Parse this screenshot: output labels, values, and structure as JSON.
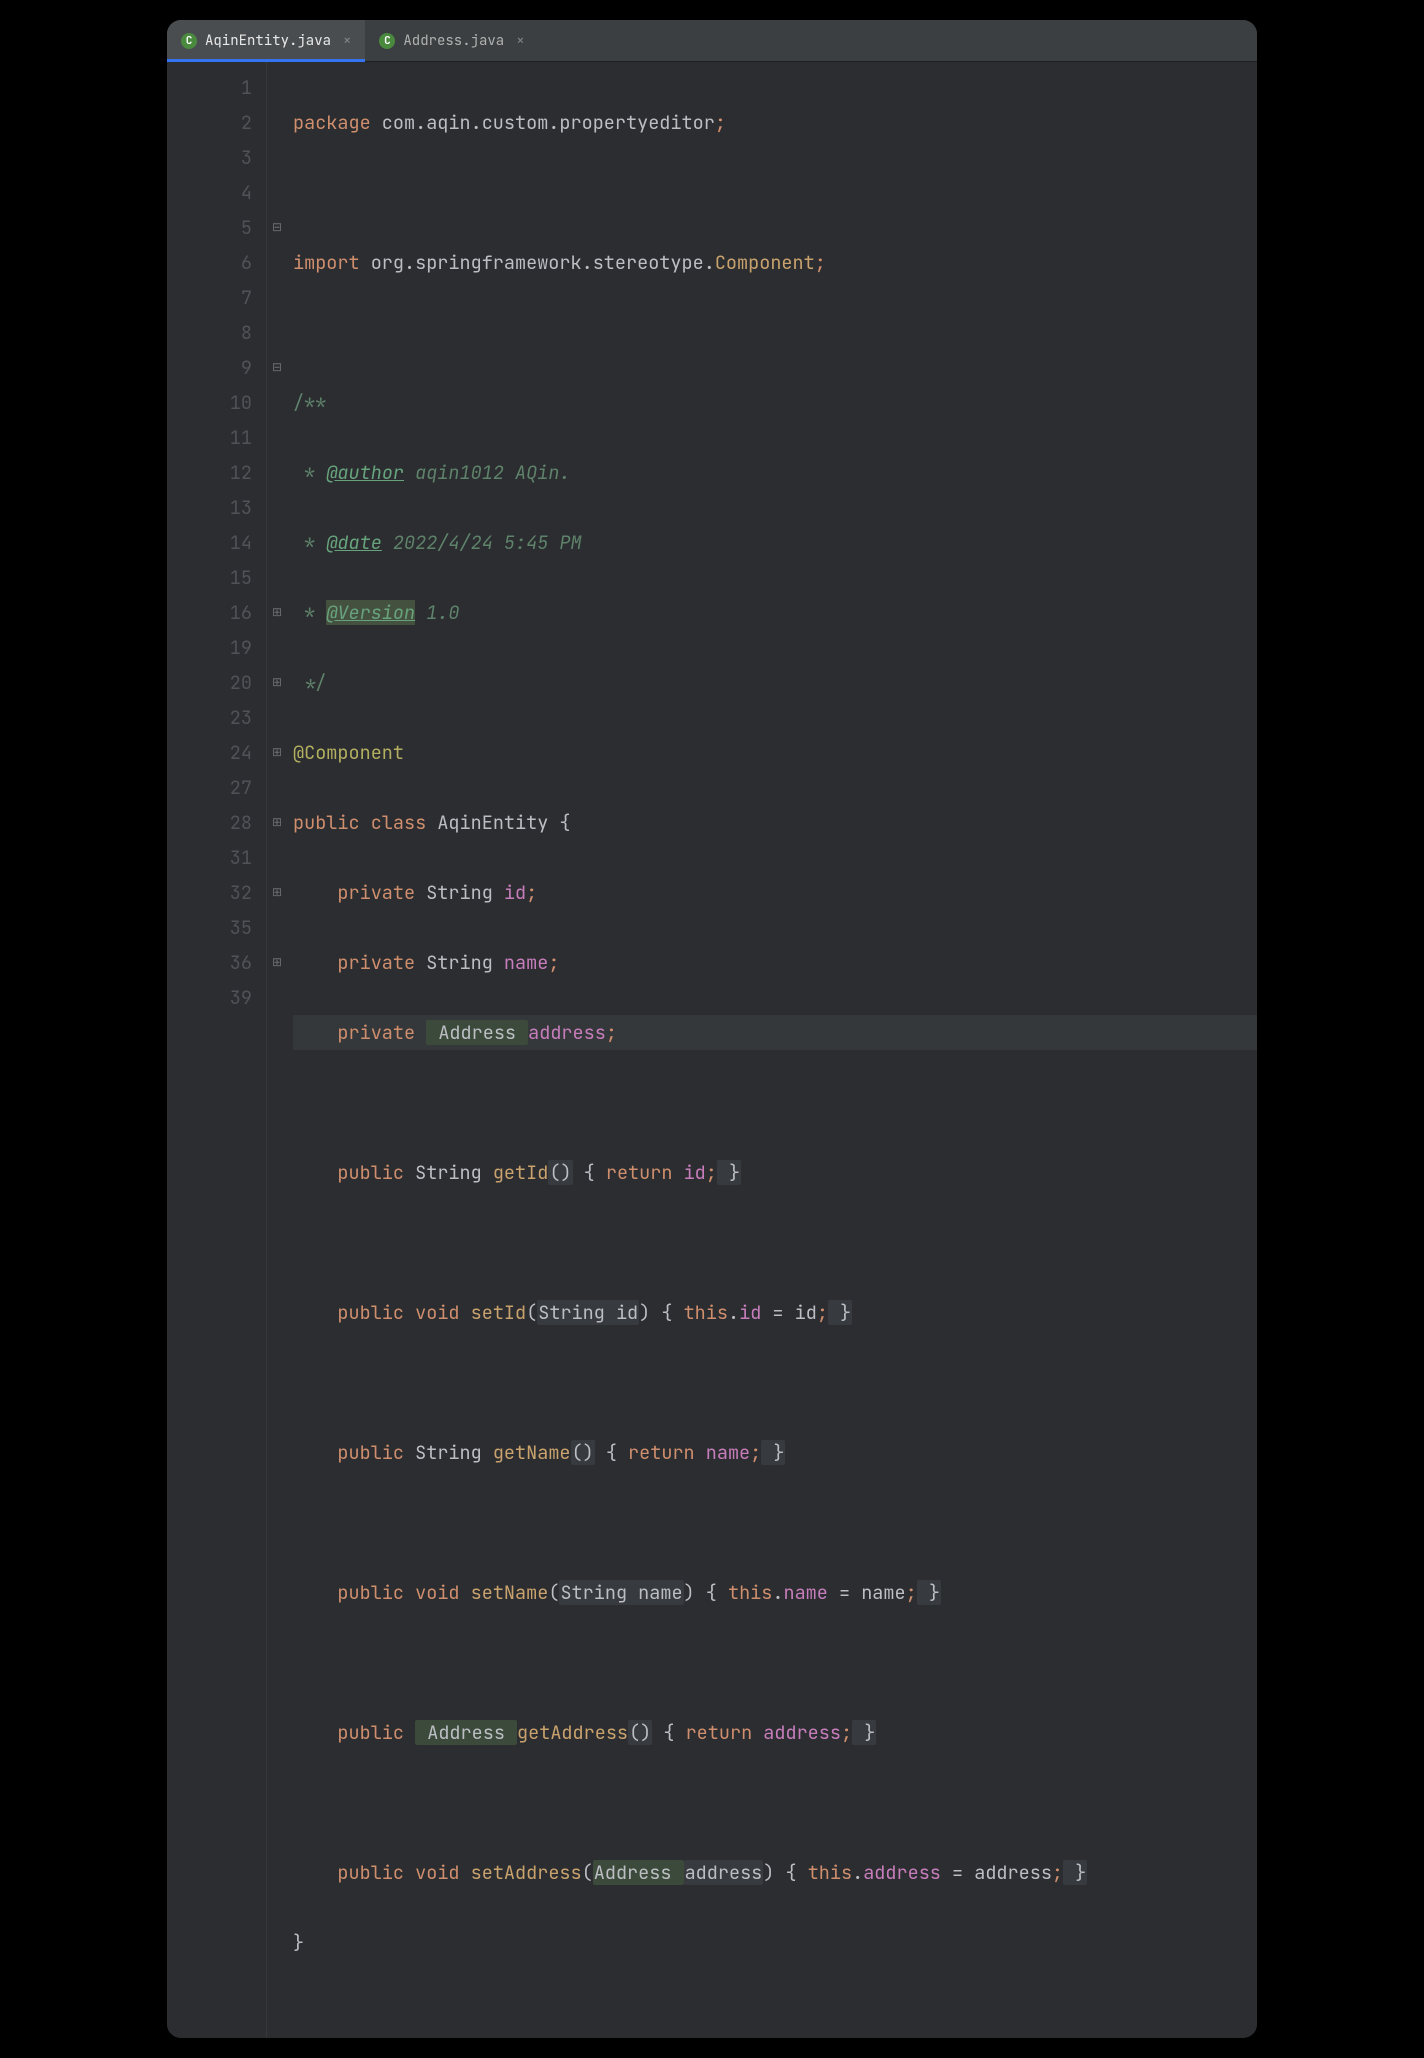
{
  "tabs": [
    {
      "label": "AqinEntity.java",
      "active": true
    },
    {
      "label": "Address.java",
      "active": false
    }
  ],
  "lineNumbers": [
    "1",
    "2",
    "3",
    "4",
    "5",
    "6",
    "7",
    "8",
    "9",
    "10",
    "11",
    "12",
    "13",
    "14",
    "15",
    "16",
    "19",
    "20",
    "23",
    "24",
    "27",
    "28",
    "31",
    "32",
    "35",
    "36",
    "39"
  ],
  "foldMarks": [
    "",
    "",
    "",
    "",
    "⊟",
    "",
    "",
    "",
    "⊟",
    "",
    "",
    "",
    "",
    "",
    "",
    "⊞",
    "",
    "⊞",
    "",
    "⊞",
    "",
    "⊞",
    "",
    "⊞",
    "",
    "⊞",
    ""
  ],
  "code": {
    "l1_kw": "package",
    "l1_pkg": " com.aqin.custom.propertyeditor",
    "l1_semi": ";",
    "l3_kw": "import",
    "l3_pkg": " org.springframework.stereotype.",
    "l3_comp": "Component",
    "l3_semi": ";",
    "l5": "/**",
    "l6_pre": " * ",
    "l6_tag": "@author",
    "l6_rest": " aqin1012 AQin.",
    "l7_pre": " * ",
    "l7_tag": "@date",
    "l7_rest": " 2022/4/24 5:45 PM",
    "l8_pre": " * ",
    "l8_tag": "@Version",
    "l8_rest": " 1.0",
    "l9": " */",
    "l10_ann": "@Component",
    "l11_kw1": "public",
    "l11_kw2": " class",
    "l11_name": " AqinEntity ",
    "l11_brace": "{",
    "l12_ind": "    ",
    "l12_kw": "private",
    "l12_type": " String ",
    "l12_field": "id",
    "l12_semi": ";",
    "l13_ind": "    ",
    "l13_kw": "private",
    "l13_type": " String ",
    "l13_field": "name",
    "l13_semi": ";",
    "l14_ind": "    ",
    "l14_kw": "private",
    "l14_type": " Address ",
    "l14_field": "address",
    "l14_semi": ";",
    "l16_ind": "    ",
    "l16_kw": "public",
    "l16_type": " String ",
    "l16_m": "getId",
    "l16_p": "()",
    "l16_b1": " { ",
    "l16_ret": "return",
    "l16_f": " id",
    "l16_s": ";",
    "l16_b2": " }",
    "l20_ind": "    ",
    "l20_kw": "public",
    "l20_void": " void ",
    "l20_m": "setId",
    "l20_po": "(",
    "l20_pt": "String ",
    "l20_pn": "id",
    "l20_pc": ")",
    "l20_b1": " { ",
    "l20_this": "this",
    "l20_dot": ".",
    "l20_f": "id",
    "l20_eq": " = ",
    "l20_v": "id",
    "l20_s": ";",
    "l20_b2": " }",
    "l24_ind": "    ",
    "l24_kw": "public",
    "l24_type": " String ",
    "l24_m": "getName",
    "l24_p": "()",
    "l24_b1": " { ",
    "l24_ret": "return",
    "l24_f": " name",
    "l24_s": ";",
    "l24_b2": " }",
    "l28_ind": "    ",
    "l28_kw": "public",
    "l28_void": " void ",
    "l28_m": "setName",
    "l28_po": "(",
    "l28_pt": "String ",
    "l28_pn": "name",
    "l28_pc": ")",
    "l28_b1": " { ",
    "l28_this": "this",
    "l28_dot": ".",
    "l28_f": "name",
    "l28_eq": " = ",
    "l28_v": "name",
    "l28_s": ";",
    "l28_b2": " }",
    "l32_ind": "    ",
    "l32_kw": "public",
    "l32_type": " Address ",
    "l32_m": "getAddress",
    "l32_p": "()",
    "l32_b1": " { ",
    "l32_ret": "return",
    "l32_f": " address",
    "l32_s": ";",
    "l32_b2": " }",
    "l36_ind": "    ",
    "l36_kw": "public",
    "l36_void": " void ",
    "l36_m": "setAddress",
    "l36_po": "(",
    "l36_pt": "Address ",
    "l36_pn": "address",
    "l36_pc": ")",
    "l36_b1": " { ",
    "l36_this": "this",
    "l36_dot": ".",
    "l36_f": "address",
    "l36_eq": " = ",
    "l36_v": "address",
    "l36_s": ";",
    "l36_b2": " }",
    "l39": "}"
  }
}
